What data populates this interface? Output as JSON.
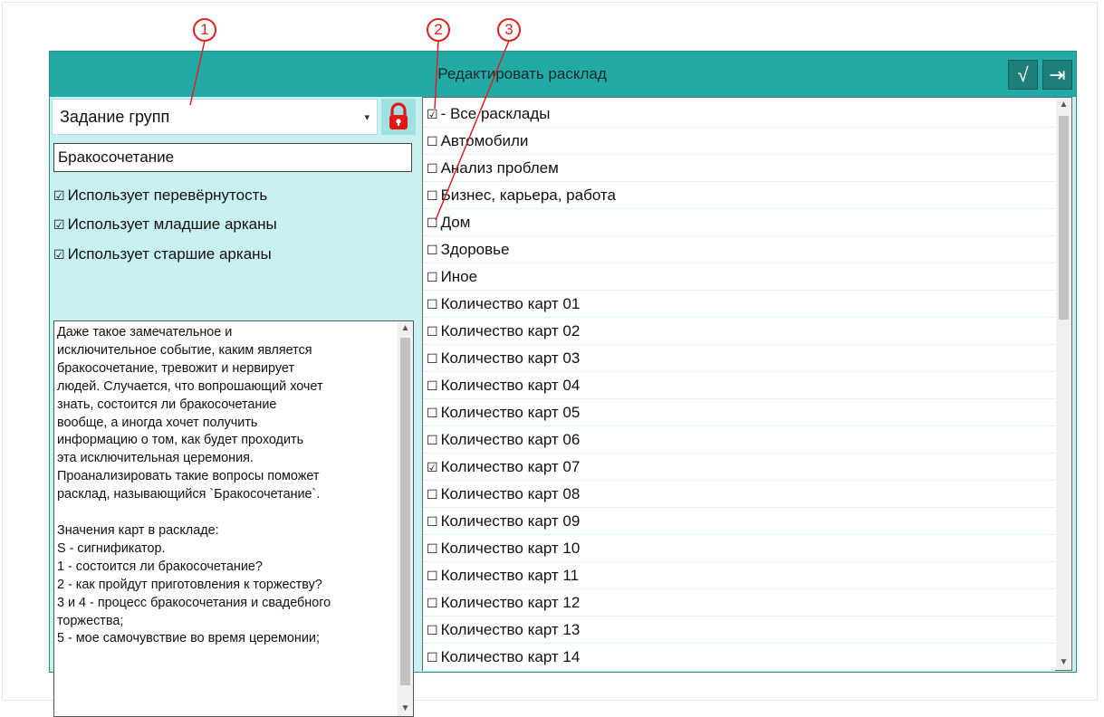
{
  "window": {
    "title": "Редактировать расклад",
    "ok_label": "√",
    "exit_label": "⇥"
  },
  "left": {
    "group_select": "Задание групп",
    "spread_name": "Бракосочетание",
    "checkboxes": [
      {
        "label": "Использует перевёрнутость",
        "checked": true,
        "mark": "☑"
      },
      {
        "label": "Использует младшие арканы",
        "checked": true,
        "mark": "☑"
      },
      {
        "label": "Использует старшие арканы",
        "checked": true,
        "mark": "☑"
      }
    ],
    "description": "Даже такое замечательное и\nисключительное событие, каким является\nбракосочетание, тревожит и нервирует\nлюдей. Случается, что вопрошающий хочет\nзнать, состоится ли бракосочетание\nвообще, а иногда хочет получить\nинформацию о том, как будет проходить\nэта исключительная церемония.\nПроанализировать такие вопросы поможет\nрасклад, называющийся `Бракосочетание`.\n\nЗначения карт в раскладе:\nS - сигнификатор.\n1 - состоится ли бракосочетание?\n2 - как пройдут приготовления к торжеству?\n3 и 4 - процесс бракосочетания и свадебного\nторжества;\n5 - мое самочувствие во время церемонии;"
  },
  "groups": [
    {
      "label": "- Все расклады",
      "checked": true,
      "mark": "☑"
    },
    {
      "label": "Автомобили",
      "checked": false,
      "mark": "☐"
    },
    {
      "label": "Анализ проблем",
      "checked": false,
      "mark": "☐"
    },
    {
      "label": "Бизнес, карьера, работа",
      "checked": false,
      "mark": "☐"
    },
    {
      "label": "Дом",
      "checked": false,
      "mark": "☐"
    },
    {
      "label": "Здоровье",
      "checked": false,
      "mark": "☐"
    },
    {
      "label": "Иное",
      "checked": false,
      "mark": "☐"
    },
    {
      "label": "Количество карт 01",
      "checked": false,
      "mark": "☐"
    },
    {
      "label": "Количество карт 02",
      "checked": false,
      "mark": "☐"
    },
    {
      "label": "Количество карт 03",
      "checked": false,
      "mark": "☐"
    },
    {
      "label": "Количество карт 04",
      "checked": false,
      "mark": "☐"
    },
    {
      "label": "Количество карт 05",
      "checked": false,
      "mark": "☐"
    },
    {
      "label": "Количество карт 06",
      "checked": false,
      "mark": "☐"
    },
    {
      "label": "Количество карт 07",
      "checked": true,
      "mark": "☑"
    },
    {
      "label": "Количество карт 08",
      "checked": false,
      "mark": "☐"
    },
    {
      "label": "Количество карт 09",
      "checked": false,
      "mark": "☐"
    },
    {
      "label": "Количество карт 10",
      "checked": false,
      "mark": "☐"
    },
    {
      "label": "Количество карт 11",
      "checked": false,
      "mark": "☐"
    },
    {
      "label": "Количество карт 12",
      "checked": false,
      "mark": "☐"
    },
    {
      "label": "Количество карт 13",
      "checked": false,
      "mark": "☐"
    },
    {
      "label": "Количество карт 14",
      "checked": false,
      "mark": "☐"
    }
  ],
  "callouts": [
    "1",
    "2",
    "3"
  ],
  "colors": {
    "title_bar": "#22aaa6",
    "panel_bg": "#c8f0f0",
    "callout": "#e02020",
    "lock": "#e01818"
  },
  "icons": {
    "lock": "lock-icon",
    "ok": "checkmark-icon",
    "exit": "exit-icon",
    "dropdown": "chevron-down-icon"
  }
}
